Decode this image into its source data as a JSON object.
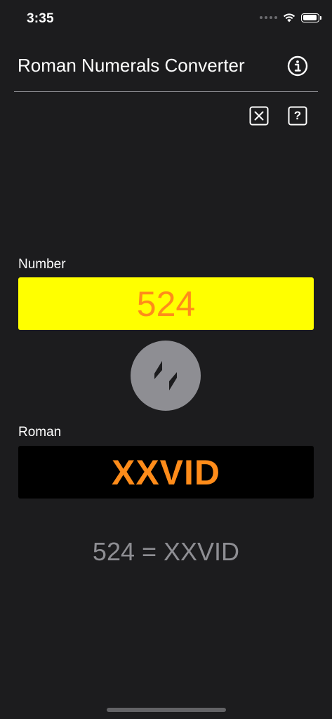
{
  "status_bar": {
    "time": "3:35",
    "battery_level": 0.95
  },
  "nav": {
    "title": "Roman Numerals Converter",
    "info_icon": "info-circle-icon"
  },
  "toolbar": {
    "clear_icon": "clear-x-square-icon",
    "help_icon": "help-question-square-icon",
    "help_glyph": "?"
  },
  "converter": {
    "number_label": "Number",
    "number_value": "524",
    "swap_icon": "swap-arrows-icon",
    "roman_label": "Roman",
    "roman_value": "XXVID",
    "result": "524 = XXVID"
  },
  "colors": {
    "background": "#1c1c1e",
    "number_field_bg": "#ffff00",
    "value_text": "#ff8c1a",
    "roman_field_bg": "#000000",
    "swap_button": "#8e8e93",
    "result_text": "#8e8e93"
  }
}
